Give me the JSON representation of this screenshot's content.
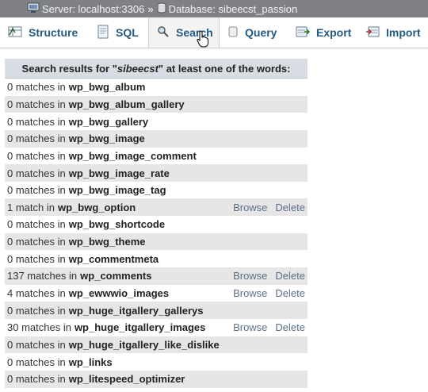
{
  "breadcrumb": {
    "server": "Server: localhost:3306",
    "separator": "»",
    "database": "Database: sibeecst_passion"
  },
  "tabs": [
    {
      "label": "Structure",
      "icon": "structure-icon"
    },
    {
      "label": "SQL",
      "icon": "sql-icon"
    },
    {
      "label": "Search",
      "icon": "search-icon",
      "active": true
    },
    {
      "label": "Query",
      "icon": "query-icon"
    },
    {
      "label": "Export",
      "icon": "export-icon"
    },
    {
      "label": "Import",
      "icon": "import-icon"
    }
  ],
  "results": {
    "header_prefix": "Search results for \"",
    "search_term": "sibeecst",
    "header_suffix": "\" at least one of the words:",
    "browse_label": "Browse",
    "delete_label": "Delete",
    "rows": [
      {
        "count": "0 matches in",
        "table": "wp_bwg_album",
        "actions": false
      },
      {
        "count": "0 matches in",
        "table": "wp_bwg_album_gallery",
        "actions": false
      },
      {
        "count": "0 matches in",
        "table": "wp_bwg_gallery",
        "actions": false
      },
      {
        "count": "0 matches in",
        "table": "wp_bwg_image",
        "actions": false
      },
      {
        "count": "0 matches in",
        "table": "wp_bwg_image_comment",
        "actions": false
      },
      {
        "count": "0 matches in",
        "table": "wp_bwg_image_rate",
        "actions": false
      },
      {
        "count": "0 matches in",
        "table": "wp_bwg_image_tag",
        "actions": false
      },
      {
        "count": "1 match in",
        "table": "wp_bwg_option",
        "actions": true
      },
      {
        "count": "0 matches in",
        "table": "wp_bwg_shortcode",
        "actions": false
      },
      {
        "count": "0 matches in",
        "table": "wp_bwg_theme",
        "actions": false
      },
      {
        "count": "0 matches in",
        "table": "wp_commentmeta",
        "actions": false
      },
      {
        "count": "137 matches in",
        "table": "wp_comments",
        "actions": true
      },
      {
        "count": "4 matches in",
        "table": "wp_ewwwio_images",
        "actions": true
      },
      {
        "count": "0 matches in",
        "table": "wp_huge_itgallery_gallerys",
        "actions": false
      },
      {
        "count": "30 matches in",
        "table": "wp_huge_itgallery_images",
        "actions": true
      },
      {
        "count": "0 matches in",
        "table": "wp_huge_itgallery_like_dislike",
        "actions": false
      },
      {
        "count": "0 matches in",
        "table": "wp_links",
        "actions": false
      },
      {
        "count": "0 matches in",
        "table": "wp_litespeed_optimizer",
        "actions": false
      }
    ]
  }
}
